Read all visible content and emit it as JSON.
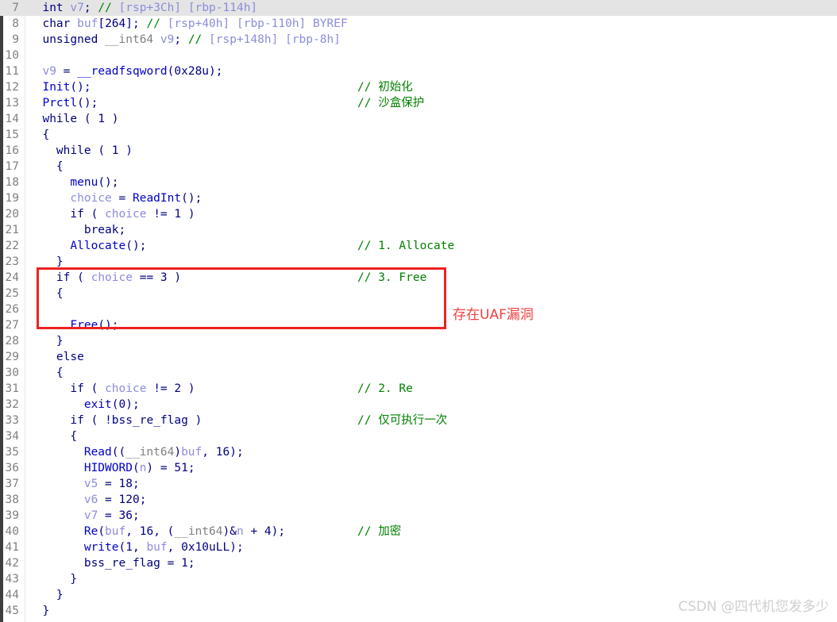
{
  "editor": {
    "kind": "ida-pseudocode-view",
    "first_line_number": 7,
    "last_line_number": 45,
    "highlighted_line_number": 7,
    "comment_color": "#008000",
    "keyword_color": "#000080",
    "function_color": "#0000c8",
    "variable_color": "#8c8cdc",
    "type_color": "#808080",
    "highlight_background": "#e4e4e4",
    "background": "#ffffff"
  },
  "lines": [
    {
      "n": "7",
      "code": "  int v7; // [rsp+3Ch] [rbp-114h]",
      "comment": ""
    },
    {
      "n": "8",
      "code": "  char buf[264]; // [rsp+40h] [rbp-110h] BYREF",
      "comment": ""
    },
    {
      "n": "9",
      "code": "  unsigned __int64 v9; // [rsp+148h] [rbp-8h]",
      "comment": ""
    },
    {
      "n": "10",
      "code": "",
      "comment": ""
    },
    {
      "n": "11",
      "code": "  v9 = __readfsqword(0x28u);",
      "comment": ""
    },
    {
      "n": "12",
      "code": "  Init();",
      "comment": "// 初始化"
    },
    {
      "n": "13",
      "code": "  Prctl();",
      "comment": "// 沙盒保护"
    },
    {
      "n": "14",
      "code": "  while ( 1 )",
      "comment": ""
    },
    {
      "n": "15",
      "code": "  {",
      "comment": ""
    },
    {
      "n": "16",
      "code": "    while ( 1 )",
      "comment": ""
    },
    {
      "n": "17",
      "code": "    {",
      "comment": ""
    },
    {
      "n": "18",
      "code": "      menu();",
      "comment": ""
    },
    {
      "n": "19",
      "code": "      choice = ReadInt();",
      "comment": ""
    },
    {
      "n": "20",
      "code": "      if ( choice != 1 )",
      "comment": ""
    },
    {
      "n": "21",
      "code": "        break;",
      "comment": ""
    },
    {
      "n": "22",
      "code": "      Allocate();",
      "comment": "// 1. Allocate"
    },
    {
      "n": "23",
      "code": "    }",
      "comment": ""
    },
    {
      "n": "24",
      "code": "    if ( choice == 3 )",
      "comment": "// 3. Free"
    },
    {
      "n": "25",
      "code": "    {",
      "comment": ""
    },
    {
      "n": "26",
      "code": "",
      "comment": ""
    },
    {
      "n": "27",
      "code": "      Free();",
      "comment": ""
    },
    {
      "n": "28",
      "code": "    }",
      "comment": ""
    },
    {
      "n": "29",
      "code": "    else",
      "comment": ""
    },
    {
      "n": "30",
      "code": "    {",
      "comment": ""
    },
    {
      "n": "31",
      "code": "      if ( choice != 2 )",
      "comment": "// 2. Re"
    },
    {
      "n": "32",
      "code": "        exit(0);",
      "comment": ""
    },
    {
      "n": "33",
      "code": "      if ( !bss_re_flag )",
      "comment": "// 仅可执行一次"
    },
    {
      "n": "34",
      "code": "      {",
      "comment": ""
    },
    {
      "n": "35",
      "code": "        Read((__int64)buf, 16);",
      "comment": ""
    },
    {
      "n": "36",
      "code": "        HIDWORD(n) = 51;",
      "comment": ""
    },
    {
      "n": "37",
      "code": "        v5 = 18;",
      "comment": ""
    },
    {
      "n": "38",
      "code": "        v6 = 120;",
      "comment": ""
    },
    {
      "n": "39",
      "code": "        v7 = 36;",
      "comment": ""
    },
    {
      "n": "40",
      "code": "        Re(buf, 16, (__int64)&n + 4);",
      "comment": "// 加密"
    },
    {
      "n": "41",
      "code": "        write(1, buf, 0x10uLL);",
      "comment": ""
    },
    {
      "n": "42",
      "code": "        bss_re_flag = 1;",
      "comment": ""
    },
    {
      "n": "43",
      "code": "      }",
      "comment": ""
    },
    {
      "n": "44",
      "code": "    }",
      "comment": ""
    },
    {
      "n": "45",
      "code": "  }",
      "comment": ""
    }
  ],
  "annotation": {
    "label": "存在UAF漏洞",
    "color": "#f04040",
    "box_color": "#ee2222"
  },
  "watermark": {
    "text": "CSDN @四代机您发多少",
    "color": "#cfcfcf"
  }
}
